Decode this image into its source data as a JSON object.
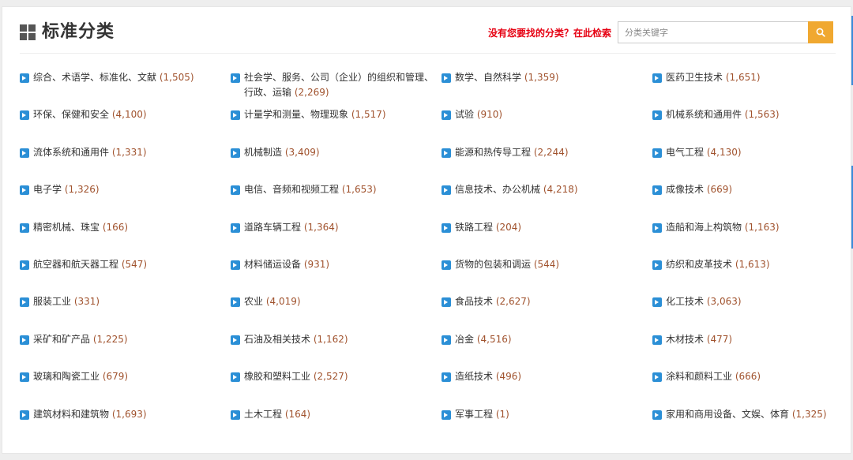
{
  "header": {
    "title": "标准分类",
    "search_prompt": "没有您要找的分类？在此检索",
    "search_placeholder": "分类关键字"
  },
  "colors": {
    "link_arrow": "#2b8fd6",
    "count_text": "#a0522d",
    "search_prompt": "#e60012",
    "search_button": "#f0a830"
  },
  "categories": [
    {
      "name": "综合、术语学、标准化、文献",
      "count": "(1,505)"
    },
    {
      "name": "社会学、服务、公司（企业）的组织和管理、行政、运输",
      "count": "(2,269)"
    },
    {
      "name": "数学、自然科学",
      "count": "(1,359)"
    },
    {
      "name": "医药卫生技术",
      "count": "(1,651)"
    },
    {
      "name": "环保、保健和安全",
      "count": "(4,100)"
    },
    {
      "name": "计量学和测量、物理现象",
      "count": "(1,517)"
    },
    {
      "name": "试验",
      "count": "(910)"
    },
    {
      "name": "机械系统和通用件",
      "count": "(1,563)"
    },
    {
      "name": "流体系统和通用件",
      "count": "(1,331)"
    },
    {
      "name": "机械制造",
      "count": "(3,409)"
    },
    {
      "name": "能源和热传导工程",
      "count": "(2,244)"
    },
    {
      "name": "电气工程",
      "count": "(4,130)"
    },
    {
      "name": "电子学",
      "count": "(1,326)"
    },
    {
      "name": "电信、音频和视频工程",
      "count": "(1,653)"
    },
    {
      "name": "信息技术、办公机械",
      "count": "(4,218)"
    },
    {
      "name": "成像技术",
      "count": "(669)"
    },
    {
      "name": "精密机械、珠宝",
      "count": "(166)"
    },
    {
      "name": "道路车辆工程",
      "count": "(1,364)"
    },
    {
      "name": "铁路工程",
      "count": "(204)"
    },
    {
      "name": "造船和海上构筑物",
      "count": "(1,163)"
    },
    {
      "name": "航空器和航天器工程",
      "count": "(547)"
    },
    {
      "name": "材料储运设备",
      "count": "(931)"
    },
    {
      "name": "货物的包装和调运",
      "count": "(544)"
    },
    {
      "name": "纺织和皮革技术",
      "count": "(1,613)"
    },
    {
      "name": "服装工业",
      "count": "(331)"
    },
    {
      "name": "农业",
      "count": "(4,019)"
    },
    {
      "name": "食品技术",
      "count": "(2,627)"
    },
    {
      "name": "化工技术",
      "count": "(3,063)"
    },
    {
      "name": "采矿和矿产品",
      "count": "(1,225)"
    },
    {
      "name": "石油及相关技术",
      "count": "(1,162)"
    },
    {
      "name": "冶金",
      "count": "(4,516)"
    },
    {
      "name": "木材技术",
      "count": "(477)"
    },
    {
      "name": "玻璃和陶瓷工业",
      "count": "(679)"
    },
    {
      "name": "橡胶和塑料工业",
      "count": "(2,527)"
    },
    {
      "name": "造纸技术",
      "count": "(496)"
    },
    {
      "name": "涂料和颜料工业",
      "count": "(666)"
    },
    {
      "name": "建筑材料和建筑物",
      "count": "(1,693)"
    },
    {
      "name": "土木工程",
      "count": "(164)"
    },
    {
      "name": "军事工程",
      "count": "(1)"
    },
    {
      "name": "家用和商用设备、文娱、体育",
      "count": "(1,325)"
    }
  ]
}
